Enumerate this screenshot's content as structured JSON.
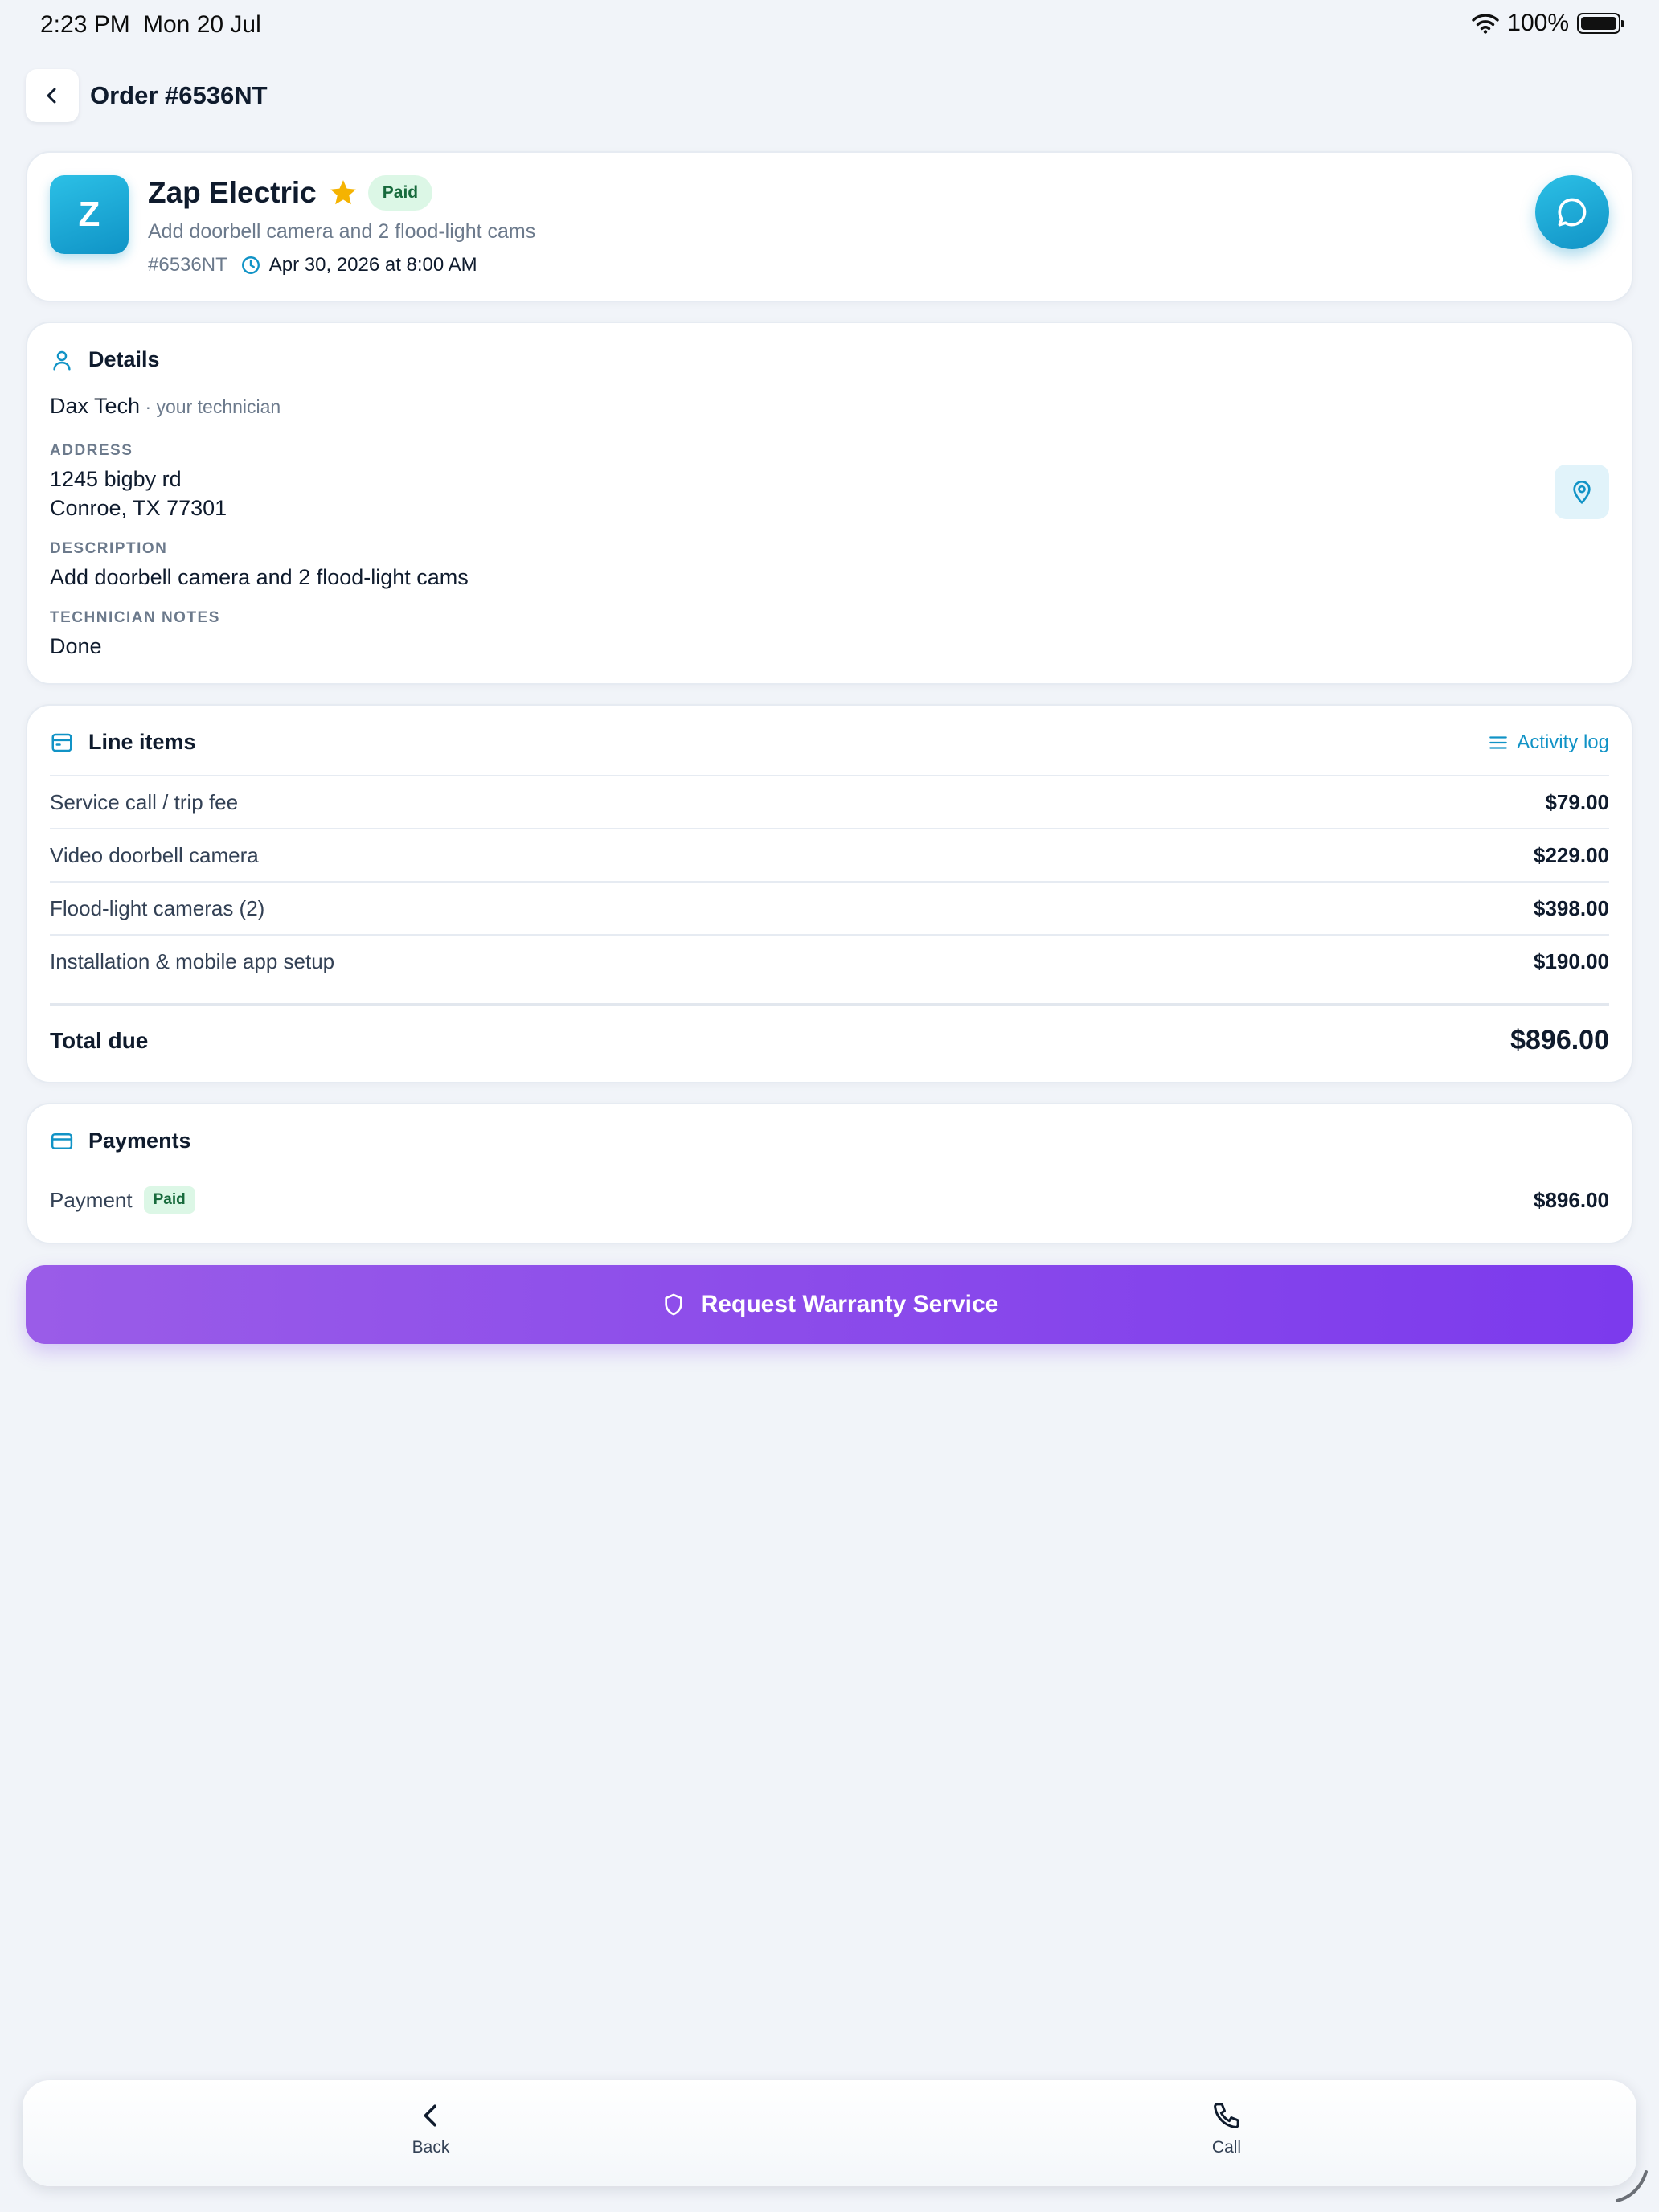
{
  "status_bar": {
    "time": "2:23 PM",
    "date": "Mon 20 Jul",
    "battery": "100%"
  },
  "header": {
    "title": "Order #6536NT"
  },
  "vendor": {
    "initial": "Z",
    "name": "Zap Electric",
    "status": "Paid",
    "subtitle": "Add doorbell camera and 2 flood-light cams",
    "order_id": "#6536NT",
    "datetime": "Apr 30, 2026 at 8:00 AM"
  },
  "details": {
    "title": "Details",
    "technician_name": "Dax Tech",
    "technician_role": " · your technician",
    "address_label": "ADDRESS",
    "address_line1": "1245 bigby rd",
    "address_line2": "Conroe, TX 77301",
    "description_label": "DESCRIPTION",
    "description": "Add doorbell camera and 2 flood-light cams",
    "notes_label": "TECHNICIAN NOTES",
    "notes": "Done"
  },
  "line_items": {
    "title": "Line items",
    "activity_label": "Activity log",
    "items": [
      {
        "label": "Service call / trip fee",
        "amount": "$79.00"
      },
      {
        "label": "Video doorbell camera",
        "amount": "$229.00"
      },
      {
        "label": "Flood-light cameras (2)",
        "amount": "$398.00"
      },
      {
        "label": "Installation & mobile app setup",
        "amount": "$190.00"
      }
    ],
    "total_label": "Total due",
    "total_amount": "$896.00"
  },
  "payments": {
    "title": "Payments",
    "label": "Payment",
    "status": "Paid",
    "amount": "$896.00"
  },
  "warranty_button": {
    "label": "Request Warranty Service"
  },
  "bottom_nav": {
    "back_label": "Back",
    "call_label": "Call"
  },
  "colors": {
    "accent": "#1193c6",
    "primary_button": "#7c3aed",
    "paid_badge_bg": "#dcf7e6",
    "paid_badge_text": "#176a3c",
    "star": "#f5b301"
  }
}
